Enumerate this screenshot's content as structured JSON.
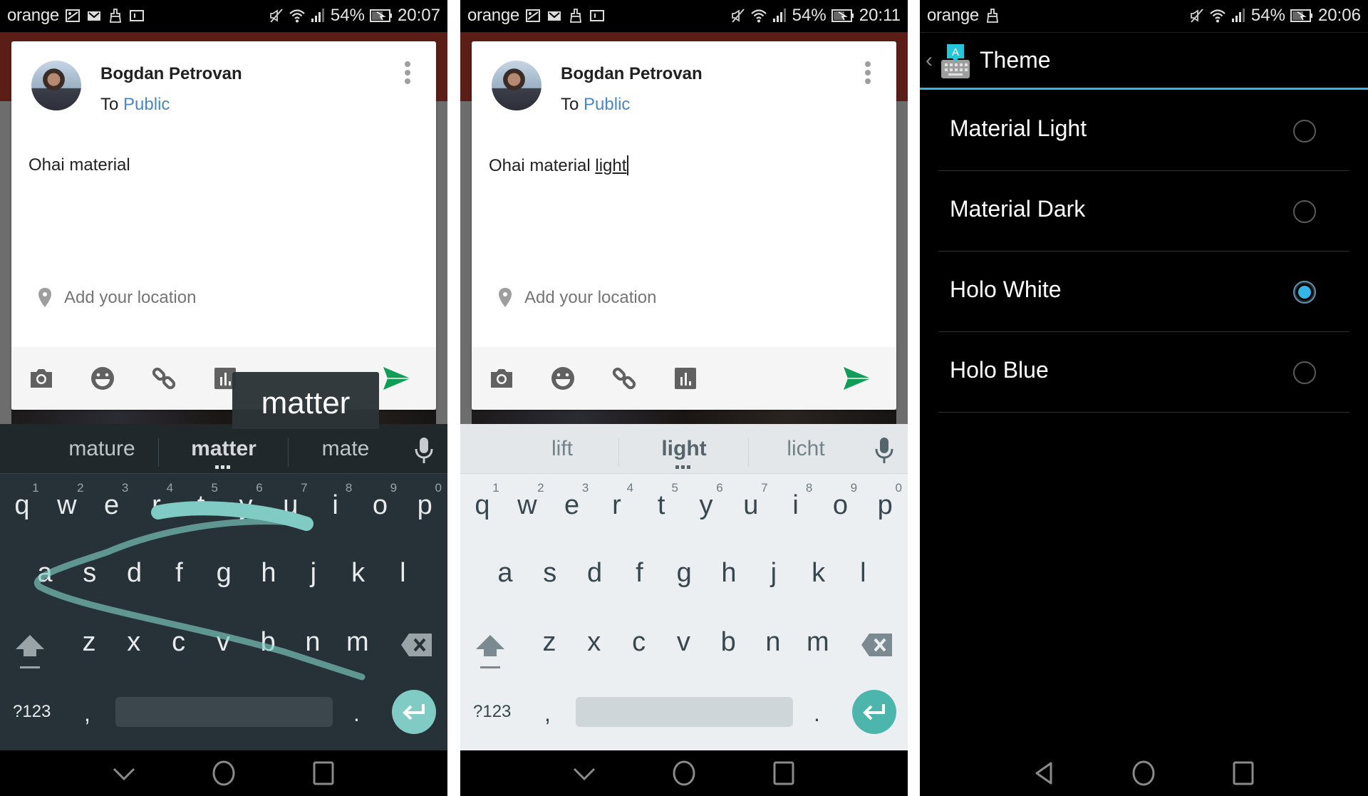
{
  "panels": [
    {
      "status": {
        "carrier": "orange",
        "battery": "54%",
        "time": "20:07"
      },
      "compose": {
        "author": "Bogdan Petrovan",
        "to_prefix": "To",
        "audience": "Public",
        "text": "Ohai material",
        "composing_word": "",
        "location_placeholder": "Add your location"
      },
      "gesture_preview": "matter",
      "keyboard": {
        "theme": "Material Dark",
        "suggestions": [
          "mature",
          "matter",
          "mate"
        ],
        "hints": [
          "1",
          "2",
          "3",
          "4",
          "5",
          "6",
          "7",
          "8",
          "9",
          "0"
        ],
        "row1": [
          "q",
          "w",
          "e",
          "r",
          "t",
          "y",
          "u",
          "i",
          "o",
          "p"
        ],
        "row2": [
          "a",
          "s",
          "d",
          "f",
          "g",
          "h",
          "j",
          "k",
          "l"
        ],
        "row3": [
          "z",
          "x",
          "c",
          "v",
          "b",
          "n",
          "m"
        ],
        "symbols_label": "?123",
        "comma": ",",
        "period": "."
      }
    },
    {
      "status": {
        "carrier": "orange",
        "battery": "54%",
        "time": "20:11"
      },
      "compose": {
        "author": "Bogdan Petrovan",
        "to_prefix": "To",
        "audience": "Public",
        "text": "Ohai material ",
        "composing_word": "light",
        "location_placeholder": "Add your location"
      },
      "keyboard": {
        "theme": "Material Light",
        "suggestions": [
          "lift",
          "light",
          "licht"
        ],
        "hints": [
          "1",
          "2",
          "3",
          "4",
          "5",
          "6",
          "7",
          "8",
          "9",
          "0"
        ],
        "row1": [
          "q",
          "w",
          "e",
          "r",
          "t",
          "y",
          "u",
          "i",
          "o",
          "p"
        ],
        "row2": [
          "a",
          "s",
          "d",
          "f",
          "g",
          "h",
          "j",
          "k",
          "l"
        ],
        "row3": [
          "z",
          "x",
          "c",
          "v",
          "b",
          "n",
          "m"
        ],
        "symbols_label": "?123",
        "comma": ",",
        "period": "."
      }
    }
  ],
  "settings": {
    "status": {
      "carrier": "orange",
      "battery": "54%",
      "time": "20:06"
    },
    "title": "Theme",
    "options": [
      {
        "label": "Material Light",
        "selected": false
      },
      {
        "label": "Material Dark",
        "selected": false
      },
      {
        "label": "Holo White",
        "selected": true
      },
      {
        "label": "Holo Blue",
        "selected": false
      }
    ]
  },
  "colors": {
    "accent_blue": "#33b5e5",
    "send_green": "#0f9d58",
    "audience_link": "#4a86c7",
    "dark_keyboard": "#263238",
    "light_keyboard": "#eceff1",
    "gesture_trail": "#80cbc4"
  },
  "icons": {
    "status_left_p1": [
      "image-icon",
      "gmail-icon",
      "brush-icon",
      "screen-icon"
    ],
    "status_right": [
      "mute-icon",
      "wifi-icon",
      "signal-icon",
      "battery-charging-icon"
    ],
    "toolbar": [
      "camera-icon",
      "emoji-icon",
      "link-icon",
      "poll-icon",
      "send-icon"
    ],
    "nav": [
      "back-icon",
      "home-icon",
      "recents-icon"
    ]
  }
}
